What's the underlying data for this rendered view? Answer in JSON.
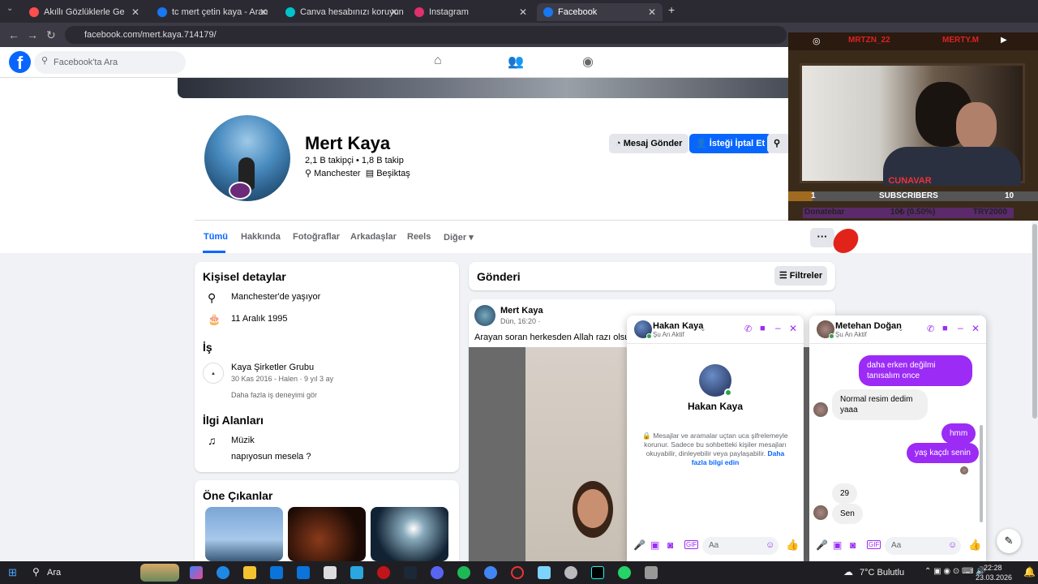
{
  "browser": {
    "tabs": [
      {
        "label": "Akıllı Gözlüklerle Geleceği G",
        "color": "#ff4e4e"
      },
      {
        "label": "tc mert çetin kaya - Arama Sor",
        "color": "#1877f2"
      },
      {
        "label": "Canva hesabınızı koruyun",
        "color": "#00c4cc"
      },
      {
        "label": "Instagram",
        "color": "#e1306c"
      },
      {
        "label": "Facebook",
        "color": "#1877f2"
      }
    ],
    "url": "facebook.com/mert.kaya.714179/"
  },
  "fb": {
    "search_placeholder": "Facebook'ta Ara",
    "profile": {
      "name": "Mert Kaya",
      "stats": "2,1 B takipçi • 1,8 B takip",
      "location": "Manchester",
      "work": "Beşiktaş",
      "btn_message": "Mesaj Gönder",
      "btn_cancel": "İsteği İptal Et",
      "btn_more": "A"
    },
    "tabs": [
      "Tümü",
      "Hakkında",
      "Fotoğraflar",
      "Arkadaşlar",
      "Reels",
      "Diğer"
    ],
    "details": {
      "title": "Kişisel detaylar",
      "lives": "Manchester'de yaşıyor",
      "birthday": "11 Aralık 1995",
      "work_title": "İş",
      "company": "Kaya Şirketler Grubu",
      "company_dates": "30 Kas 2016 - Halen · 9 yıl 3 ay",
      "more_work": "Daha fazla iş deneyimi gör",
      "interests_title": "İlgi Alanları",
      "interest1": "Müzik",
      "interest2": "napıyosun mesela ?"
    },
    "highlights_title": "Öne Çıkanlar",
    "posts": {
      "title": "Gönderi",
      "filter": "Filtreler",
      "author": "Mert Kaya",
      "time": "Dün, 16:20 ·",
      "text": "Arayan soran herkesden Allah razı olsun 🙏"
    }
  },
  "chat1": {
    "name": "Hakan Kaya",
    "status": "Şu An Aktif",
    "center_name": "Hakan Kaya",
    "notice": "Mesajlar ve aramalar uçtan uca şifrelemeyle korunur. Sadece bu sohbetteki kişiler mesajları okuyabilir, dinleyebilir veya paylaşabilir.",
    "notice_link": "Daha fazla bilgi edin",
    "input_placeholder": "Aa"
  },
  "chat2": {
    "name": "Metehan Doğan",
    "status": "Şu An Aktif",
    "messages": [
      {
        "dir": "out",
        "text": "daha erken değilmi tanısalım once"
      },
      {
        "dir": "in",
        "text": "Normal resim dedim yaaa"
      },
      {
        "dir": "out",
        "text": "hmm"
      },
      {
        "dir": "out",
        "text": "yaş kaçdı senin"
      },
      {
        "dir": "in",
        "text": "29"
      },
      {
        "dir": "in",
        "text": "Sen"
      }
    ],
    "input_placeholder": "Aa"
  },
  "stream": {
    "left_name": "MRTZN_22",
    "right_name": "MERTY.M",
    "cam_label": "CUNAVAR",
    "sub_left": "1",
    "sub_label": "SUBSCRIBERS",
    "sub_right": "10",
    "donate_label": "Donatebar",
    "donate_amount": "10₺ (0.50%)",
    "donate_goal": "TRY2000"
  },
  "taskbar": {
    "search": "Ara",
    "weather": "7°C Bulutlu",
    "time": "22:28",
    "date": "23.03.2026"
  }
}
